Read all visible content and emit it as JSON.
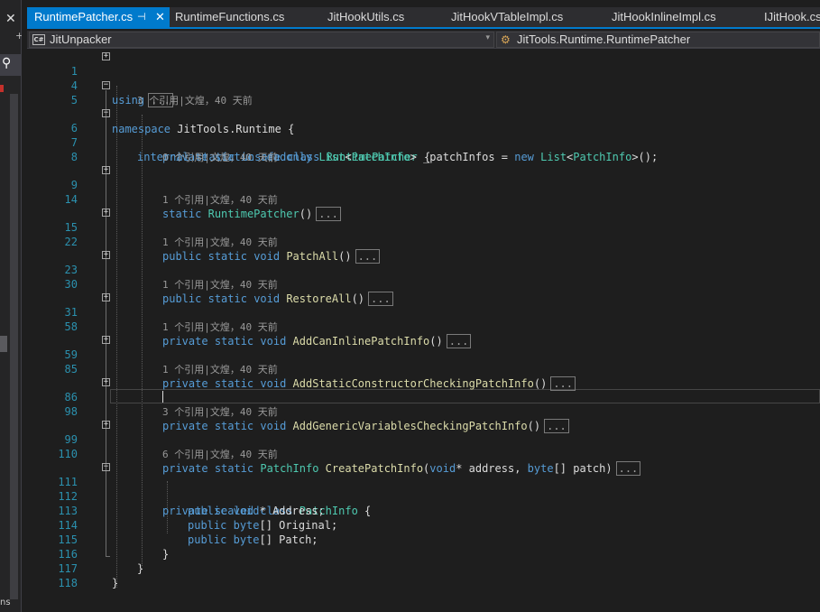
{
  "tabs": [
    {
      "label": "RuntimePatcher.cs",
      "active": true,
      "pin": "⊣",
      "close": "✕"
    },
    {
      "label": "RuntimeFunctions.cs"
    },
    {
      "label": "JitHookUtils.cs"
    },
    {
      "label": "JitHookVTableImpl.cs"
    },
    {
      "label": "JitHookInlineImpl.cs"
    },
    {
      "label": "IJitHook.cs"
    }
  ],
  "nav": {
    "project": "JitUnpacker",
    "project_icon": "C#",
    "member": "JitTools.Runtime.RuntimePatcher",
    "dropdown_arrow": "▾"
  },
  "left_panel": {
    "close": "✕",
    "search_glyph": "⚲",
    "cut_text": "ns"
  },
  "lens": {
    "c3": "3 个引用|文煌，40 天前",
    "c0": "0 个引用|文煌，40 天前",
    "c1": "1 个引用|文煌，40 天前",
    "c6": "6 个引用|文煌，40 天前"
  },
  "code": {
    "ellipsis": "...",
    "using": "using",
    "namespace_kw": "namespace",
    "namespace_name": "JitTools.Runtime {",
    "internal": "internal",
    "static": "static",
    "unsafe": "unsafe",
    "class": "class",
    "class_name": "RuntimePatcher",
    "private": "private",
    "public": "public",
    "readonly": "readonly",
    "void": "void",
    "new": "new",
    "sealed": "sealed",
    "byte": "byte",
    "list": "List",
    "patchinfo": "PatchInfo",
    "patchinfos_field": " _patchInfos = ",
    "ctor_end": "();",
    "open_brace": " {",
    "close_brace": "}",
    "ctor": "RuntimePatcher",
    "patch_all": "PatchAll",
    "restore_all": "RestoreAll",
    "add_can_inline": "AddCanInlinePatchInfo",
    "add_static_ctor": "AddStaticConstructorCheckingPatchInfo",
    "add_generic": "AddGenericVariablesCheckingPatchInfo",
    "create_patch": "CreatePatchInfo",
    "create_params_a": "(",
    "create_params_b": "* address, ",
    "create_params_c": "[] patch)",
    "parens": "()",
    "lt": "<",
    "gt": ">",
    "address_field": "* Address;",
    "original_field": "[] Original;",
    "patch_field": "[] Patch;"
  },
  "line_numbers": [
    "1",
    "4",
    "5",
    "6",
    "7",
    "8",
    "9",
    "14",
    "15",
    "22",
    "23",
    "30",
    "31",
    "58",
    "59",
    "85",
    "86",
    "98",
    "99",
    "110",
    "111",
    "112",
    "113",
    "114",
    "115",
    "116",
    "117",
    "118"
  ]
}
